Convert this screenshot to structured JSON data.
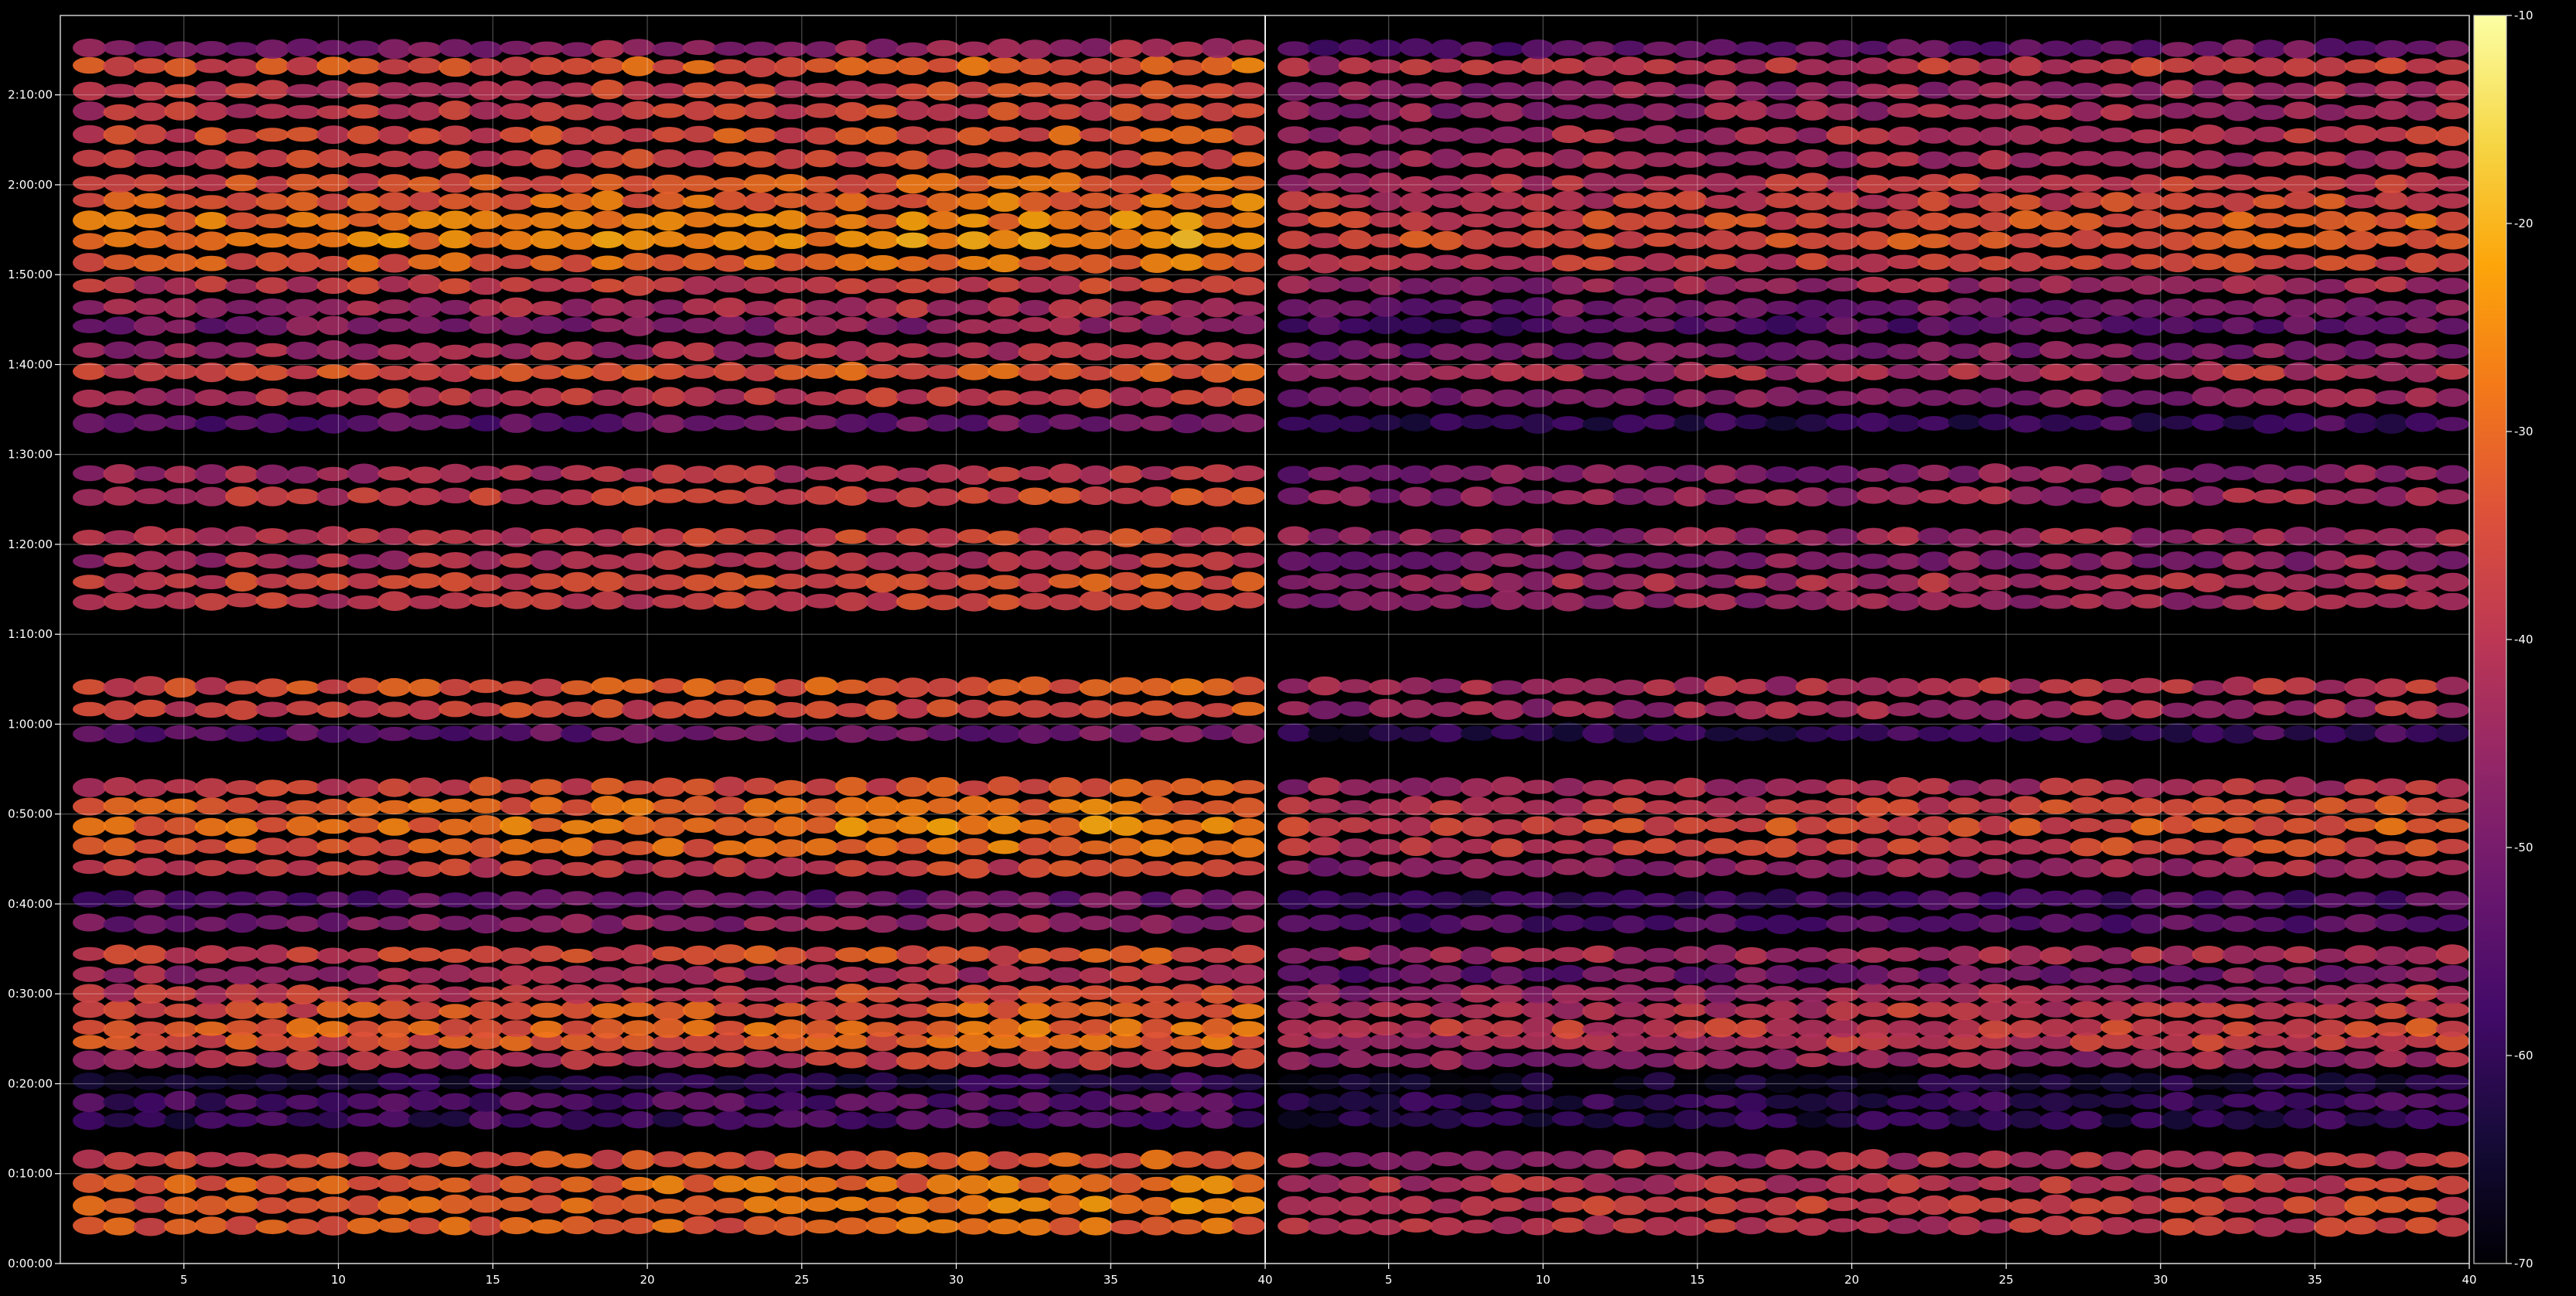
{
  "chart_data": [
    {
      "type": "heatmap",
      "panel": "left",
      "x_ticks": [
        "5",
        "10",
        "15",
        "20",
        "25",
        "30",
        "35",
        "40"
      ],
      "x_tick_values": [
        5,
        10,
        15,
        20,
        25,
        30,
        35,
        40
      ],
      "xlim": [
        1,
        40
      ],
      "y_ticks": [
        "0:00:00",
        "0:10:00",
        "0:20:00",
        "0:30:00",
        "0:40:00",
        "0:50:00",
        "1:00:00",
        "1:10:00",
        "1:20:00",
        "1:30:00",
        "1:40:00",
        "1:50:00",
        "2:00:00",
        "2:10:00"
      ],
      "y_tick_seconds": [
        0,
        600,
        1200,
        1800,
        2400,
        3000,
        3600,
        4200,
        4800,
        5400,
        6000,
        6600,
        7200,
        7800
      ],
      "ylim_seconds": [
        0,
        8330
      ],
      "columns": 39,
      "grid": true,
      "color_map": "inferno",
      "value_range": [
        -70,
        -10
      ],
      "band_levels": [
        {
          "time_s": 250,
          "level": -34
        },
        {
          "time_s": 390,
          "level": -32
        },
        {
          "time_s": 530,
          "level": -33
        },
        {
          "time_s": 690,
          "level": -36
        },
        {
          "time_s": 960,
          "level": -60
        },
        {
          "time_s": 1080,
          "level": -58
        },
        {
          "time_s": 1210,
          "level": -64
        },
        {
          "time_s": 1360,
          "level": -42
        },
        {
          "time_s": 1480,
          "level": -35
        },
        {
          "time_s": 1570,
          "level": -33
        },
        {
          "time_s": 1690,
          "level": -35
        },
        {
          "time_s": 1800,
          "level": -40
        },
        {
          "time_s": 1930,
          "level": -45
        },
        {
          "time_s": 2060,
          "level": -38
        },
        {
          "time_s": 2270,
          "level": -50
        },
        {
          "time_s": 2430,
          "level": -55
        },
        {
          "time_s": 2640,
          "level": -40
        },
        {
          "time_s": 2780,
          "level": -33
        },
        {
          "time_s": 2920,
          "level": -30
        },
        {
          "time_s": 3050,
          "level": -33
        },
        {
          "time_s": 3180,
          "level": -38
        },
        {
          "time_s": 3540,
          "level": -55
        },
        {
          "time_s": 3700,
          "level": -38
        },
        {
          "time_s": 3850,
          "level": -36
        },
        {
          "time_s": 4420,
          "level": -40
        },
        {
          "time_s": 4550,
          "level": -38
        },
        {
          "time_s": 4690,
          "level": -43
        },
        {
          "time_s": 4850,
          "level": -40
        },
        {
          "time_s": 5120,
          "level": -40
        },
        {
          "time_s": 5270,
          "level": -44
        },
        {
          "time_s": 5610,
          "level": -55
        },
        {
          "time_s": 5780,
          "level": -42
        },
        {
          "time_s": 5950,
          "level": -36
        },
        {
          "time_s": 6090,
          "level": -45
        },
        {
          "time_s": 6260,
          "level": -50
        },
        {
          "time_s": 6380,
          "level": -45
        },
        {
          "time_s": 6530,
          "level": -40
        },
        {
          "time_s": 6680,
          "level": -33
        },
        {
          "time_s": 6830,
          "level": -28
        },
        {
          "time_s": 6960,
          "level": -30
        },
        {
          "time_s": 7090,
          "level": -33
        },
        {
          "time_s": 7210,
          "level": -35
        },
        {
          "time_s": 7370,
          "level": -38
        },
        {
          "time_s": 7530,
          "level": -37
        },
        {
          "time_s": 7690,
          "level": -40
        },
        {
          "time_s": 7830,
          "level": -40
        },
        {
          "time_s": 7990,
          "level": -35
        },
        {
          "time_s": 8110,
          "level": -48
        }
      ]
    },
    {
      "type": "heatmap",
      "panel": "right",
      "x_ticks": [
        "5",
        "10",
        "15",
        "20",
        "25",
        "30",
        "35",
        "40"
      ],
      "x_tick_values": [
        5,
        10,
        15,
        20,
        25,
        30,
        35,
        40
      ],
      "xlim": [
        1,
        40
      ],
      "ylim_seconds": [
        0,
        8330
      ],
      "columns": 39,
      "grid": true,
      "color_map": "inferno",
      "value_range": [
        -70,
        -10
      ],
      "band_levels": [
        {
          "time_s": 250,
          "level": -42
        },
        {
          "time_s": 390,
          "level": -40
        },
        {
          "time_s": 530,
          "level": -42
        },
        {
          "time_s": 690,
          "level": -45
        },
        {
          "time_s": 960,
          "level": -64
        },
        {
          "time_s": 1080,
          "level": -62
        },
        {
          "time_s": 1210,
          "level": -67
        },
        {
          "time_s": 1360,
          "level": -48
        },
        {
          "time_s": 1480,
          "level": -42
        },
        {
          "time_s": 1570,
          "level": -40
        },
        {
          "time_s": 1690,
          "level": -42
        },
        {
          "time_s": 1800,
          "level": -47
        },
        {
          "time_s": 1930,
          "level": -53
        },
        {
          "time_s": 2060,
          "level": -45
        },
        {
          "time_s": 2270,
          "level": -57
        },
        {
          "time_s": 2430,
          "level": -60
        },
        {
          "time_s": 2640,
          "level": -47
        },
        {
          "time_s": 2780,
          "level": -40
        },
        {
          "time_s": 2920,
          "level": -37
        },
        {
          "time_s": 3050,
          "level": -40
        },
        {
          "time_s": 3180,
          "level": -45
        },
        {
          "time_s": 3540,
          "level": -62
        },
        {
          "time_s": 3700,
          "level": -46
        },
        {
          "time_s": 3850,
          "level": -44
        },
        {
          "time_s": 4420,
          "level": -47
        },
        {
          "time_s": 4550,
          "level": -45
        },
        {
          "time_s": 4690,
          "level": -50
        },
        {
          "time_s": 4850,
          "level": -47
        },
        {
          "time_s": 5120,
          "level": -47
        },
        {
          "time_s": 5270,
          "level": -50
        },
        {
          "time_s": 5610,
          "level": -62
        },
        {
          "time_s": 5780,
          "level": -50
        },
        {
          "time_s": 5950,
          "level": -44
        },
        {
          "time_s": 6090,
          "level": -52
        },
        {
          "time_s": 6260,
          "level": -57
        },
        {
          "time_s": 6380,
          "level": -52
        },
        {
          "time_s": 6530,
          "level": -47
        },
        {
          "time_s": 6680,
          "level": -40
        },
        {
          "time_s": 6830,
          "level": -35
        },
        {
          "time_s": 6960,
          "level": -37
        },
        {
          "time_s": 7090,
          "level": -40
        },
        {
          "time_s": 7210,
          "level": -42
        },
        {
          "time_s": 7370,
          "level": -45
        },
        {
          "time_s": 7530,
          "level": -44
        },
        {
          "time_s": 7690,
          "level": -47
        },
        {
          "time_s": 7830,
          "level": -47
        },
        {
          "time_s": 7990,
          "level": -42
        },
        {
          "time_s": 8110,
          "level": -55
        }
      ]
    },
    {
      "type": "colorbar",
      "color_map": "inferno",
      "range": [
        -70,
        -10
      ],
      "ticks": [
        "-10",
        "-20",
        "-30",
        "-40",
        "-50",
        "-60",
        "-70"
      ],
      "tick_values": [
        -10,
        -20,
        -30,
        -40,
        -50,
        -60,
        -70
      ]
    }
  ]
}
